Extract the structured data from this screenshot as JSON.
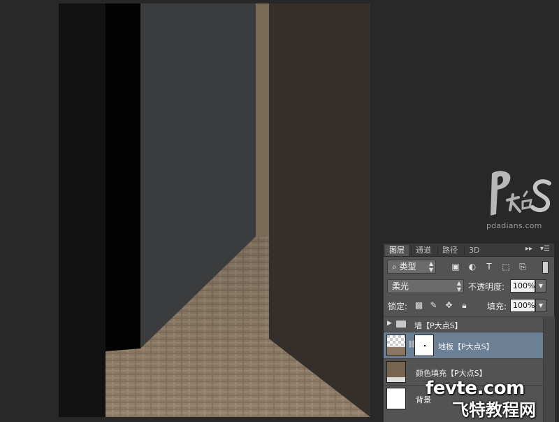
{
  "watermark": {
    "logo_text": "pdadians.com"
  },
  "layers_panel": {
    "tabs": [
      "图层",
      "通道",
      "路径",
      "3D"
    ],
    "filter": {
      "label": "类型"
    },
    "blend_mode": "柔光",
    "opacity": {
      "label": "不透明度:",
      "value": "100%"
    },
    "lock": {
      "label": "锁定:"
    },
    "fill": {
      "label": "填充:",
      "value": "100%"
    },
    "layers": [
      {
        "name": "墙【P大点S】",
        "type": "group"
      },
      {
        "name": "地板【P大点S】",
        "selected": true
      },
      {
        "name": "颜色填充【P大点S】"
      },
      {
        "name": "背景"
      }
    ],
    "colors": {
      "selected_row": "#6c8095",
      "panel_bg": "#535353"
    }
  },
  "site_watermark": {
    "domain": "fevte.com",
    "text_cn": "飞特教程网"
  }
}
